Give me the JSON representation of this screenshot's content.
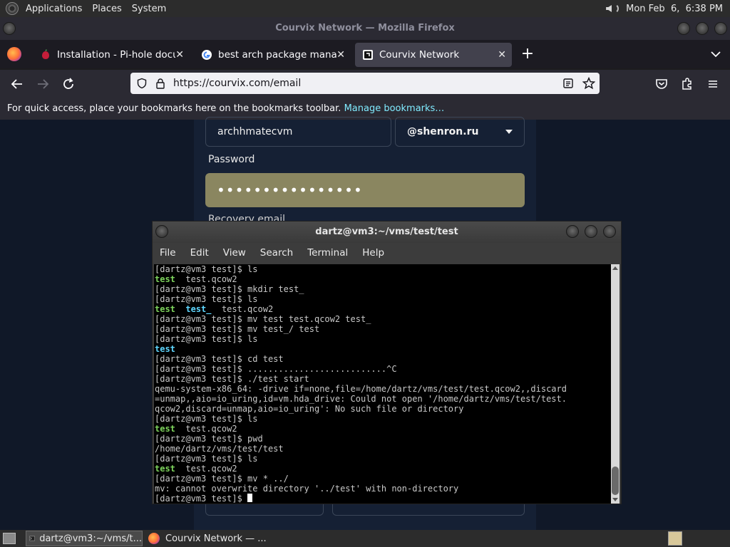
{
  "top_panel": {
    "menus": [
      "Applications",
      "Places",
      "System"
    ],
    "clock": "Mon Feb  6,  6:38 PM"
  },
  "firefox": {
    "window_title": "Courvix Network — Mozilla Firefox",
    "tabs": [
      {
        "label": "Installation - Pi-hole documentation",
        "favicon": "pihole-icon"
      },
      {
        "label": "best arch package manager",
        "favicon": "google-icon"
      },
      {
        "label": "Courvix Network",
        "favicon": "courvix-icon"
      }
    ],
    "url": "https://courvix.com/email",
    "bookmarks_bar": {
      "text": "For quick access, place your bookmarks here on the bookmarks toolbar.",
      "link": "Manage bookmarks…"
    }
  },
  "page": {
    "username_value": "archhmatecvm",
    "domain_select": "@shenron.ru",
    "password_label": "Password",
    "password_value": "••••••••••••••••",
    "recovery_label": "Recovery email"
  },
  "terminal": {
    "title": "dartz@vm3:~/vms/test/test",
    "menu": [
      "File",
      "Edit",
      "View",
      "Search",
      "Terminal",
      "Help"
    ],
    "lines": [
      "[dartz@vm3 test]$ ls",
      "test  test.qcow2",
      "[dartz@vm3 test]$ mkdir test_",
      "[dartz@vm3 test]$ ls",
      "test  test_  test.qcow2",
      "[dartz@vm3 test]$ mv test test.qcow2 test_",
      "[dartz@vm3 test]$ mv test_/ test",
      "[dartz@vm3 test]$ ls",
      "test",
      "[dartz@vm3 test]$ cd test",
      "[dartz@vm3 test]$ ...........................^C",
      "[dartz@vm3 test]$ ./test start",
      "qemu-system-x86_64: -drive if=none,file=/home/dartz/vms/test/test.qcow2,,discard",
      "=unmap,,aio=io_uring,id=vm.hda_drive: Could not open '/home/dartz/vms/test/test.",
      "qcow2,discard=unmap,aio=io_uring': No such file or directory",
      "[dartz@vm3 test]$ ls",
      "test  test.qcow2",
      "[dartz@vm3 test]$ pwd",
      "/home/dartz/vms/test/test",
      "[dartz@vm3 test]$ ls",
      "test  test.qcow2",
      "[dartz@vm3 test]$ mv * ../",
      "mv: cannot overwrite directory '../test' with non-directory",
      "[dartz@vm3 test]$ "
    ]
  },
  "taskbar": {
    "items": [
      "dartz@vm3:~/vms/t...",
      "Courvix Network — ..."
    ]
  }
}
